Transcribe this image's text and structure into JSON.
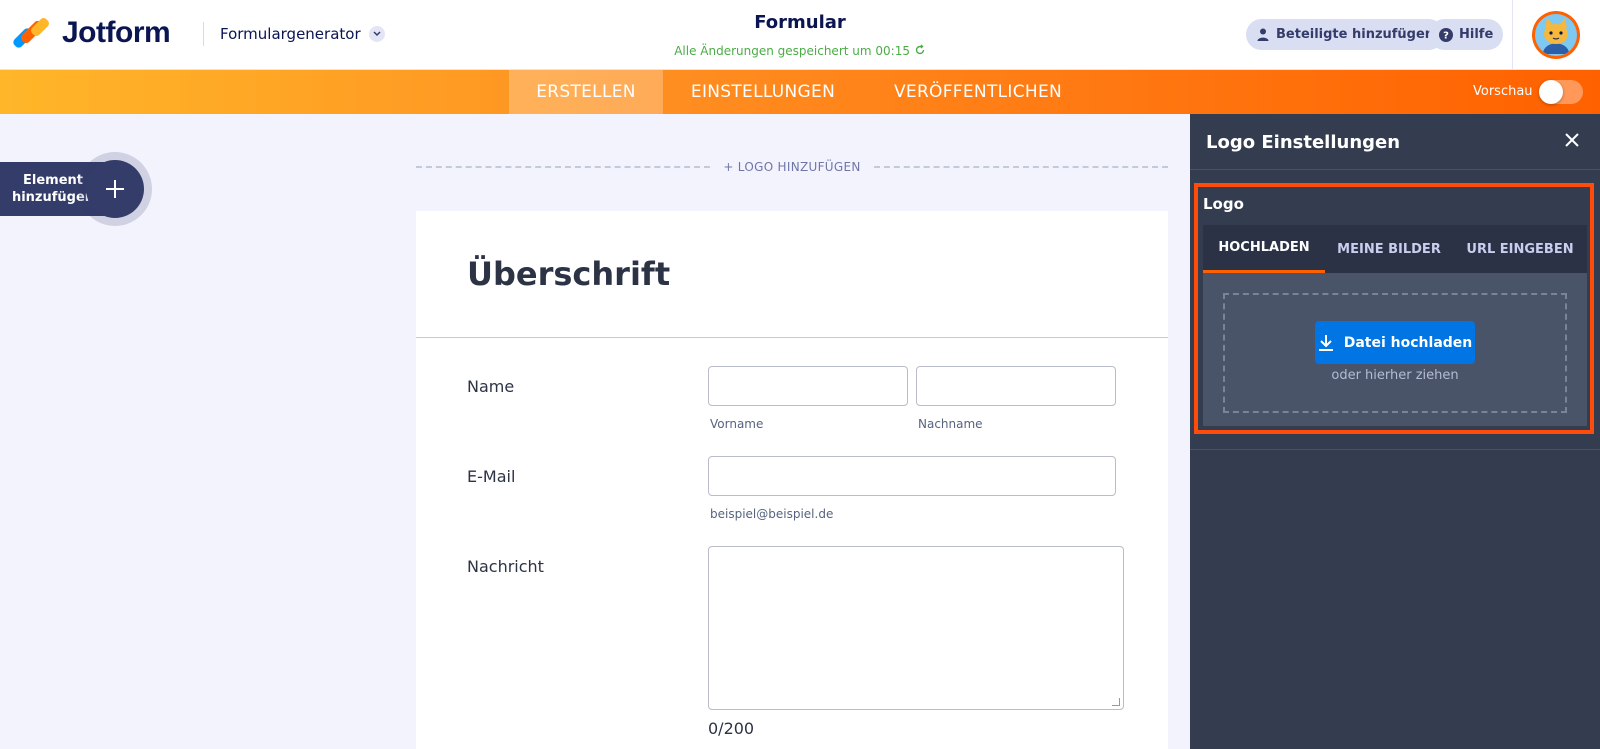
{
  "header": {
    "brand": "Jotform",
    "generator_label": "Formulargenerator",
    "form_title": "Formular",
    "save_status": "Alle Änderungen gespeichert um 00:15",
    "invite_label": "Beteiligte hinzufügen",
    "help_label": "Hilfe"
  },
  "nav": {
    "tabs": [
      {
        "label": "ERSTELLEN"
      },
      {
        "label": "EINSTELLUNGEN"
      },
      {
        "label": "VERÖFFENTLICHEN"
      }
    ],
    "preview_label": "Vorschau"
  },
  "canvas": {
    "add_element_label": "Element hinzufügen",
    "add_logo_label": "+ LOGO HINZUFÜGEN"
  },
  "form": {
    "heading": "Überschrift",
    "fields": {
      "name_label": "Name",
      "first_name_sublabel": "Vorname",
      "last_name_sublabel": "Nachname",
      "email_label": "E-Mail",
      "email_sublabel": "beispiel@beispiel.de",
      "message_label": "Nachricht",
      "message_counter": "0/200"
    }
  },
  "panel": {
    "title": "Logo Einstellungen",
    "section_title": "Logo",
    "tabs": [
      {
        "label": "HOCHLADEN"
      },
      {
        "label": "MEINE BILDER"
      },
      {
        "label": "URL EINGEBEN"
      }
    ],
    "upload_button": "Datei hochladen",
    "drop_hint": "oder hierher ziehen"
  },
  "colors": {
    "brand_orange": "#ff6100",
    "upload_blue": "#0075e3",
    "saved_green": "#4cac47",
    "highlight": "#ff4c0b"
  }
}
